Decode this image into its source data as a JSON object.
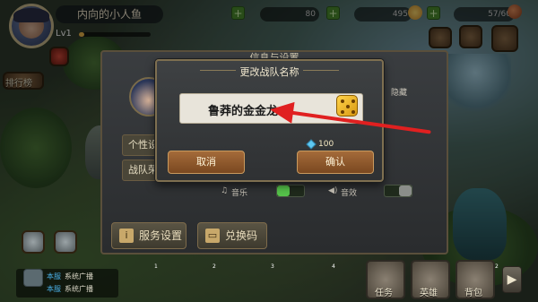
{
  "player": {
    "name": "内向的小人鱼",
    "level_label": "Lv1",
    "level_progress": 0.08
  },
  "resources": {
    "food": "80",
    "coins": "495",
    "energy": "57/60"
  },
  "sidebar": {
    "leaderboard_label": "排行榜"
  },
  "settings_panel": {
    "title": "信息与设置",
    "personal_btn": "个性设",
    "team_btn": "战队荣",
    "flag_text": "隐藏",
    "music_label": "音乐",
    "sound_label": "音效",
    "server_btn": "服务设置",
    "redeem_btn": "兑换码"
  },
  "rename_modal": {
    "title": "更改战队名称",
    "input_value": "鲁莽的金金龙",
    "cost": "100",
    "cancel_label": "取消",
    "confirm_label": "确认"
  },
  "chat": {
    "lines": [
      {
        "tag": "本服",
        "text": "系统广播"
      },
      {
        "tag": "本服",
        "text": "系统广播"
      }
    ]
  },
  "hotbar": {
    "slot_numbers": [
      "1",
      "2",
      "3",
      "4",
      "1",
      "2"
    ]
  },
  "bottom_nav": {
    "tasks": "任务",
    "heroes": "英雄",
    "bag": "背包"
  },
  "colors": {
    "arrow": "#e02020",
    "toggle_on": "#55c24a",
    "accent_button": "#a46b3a"
  }
}
